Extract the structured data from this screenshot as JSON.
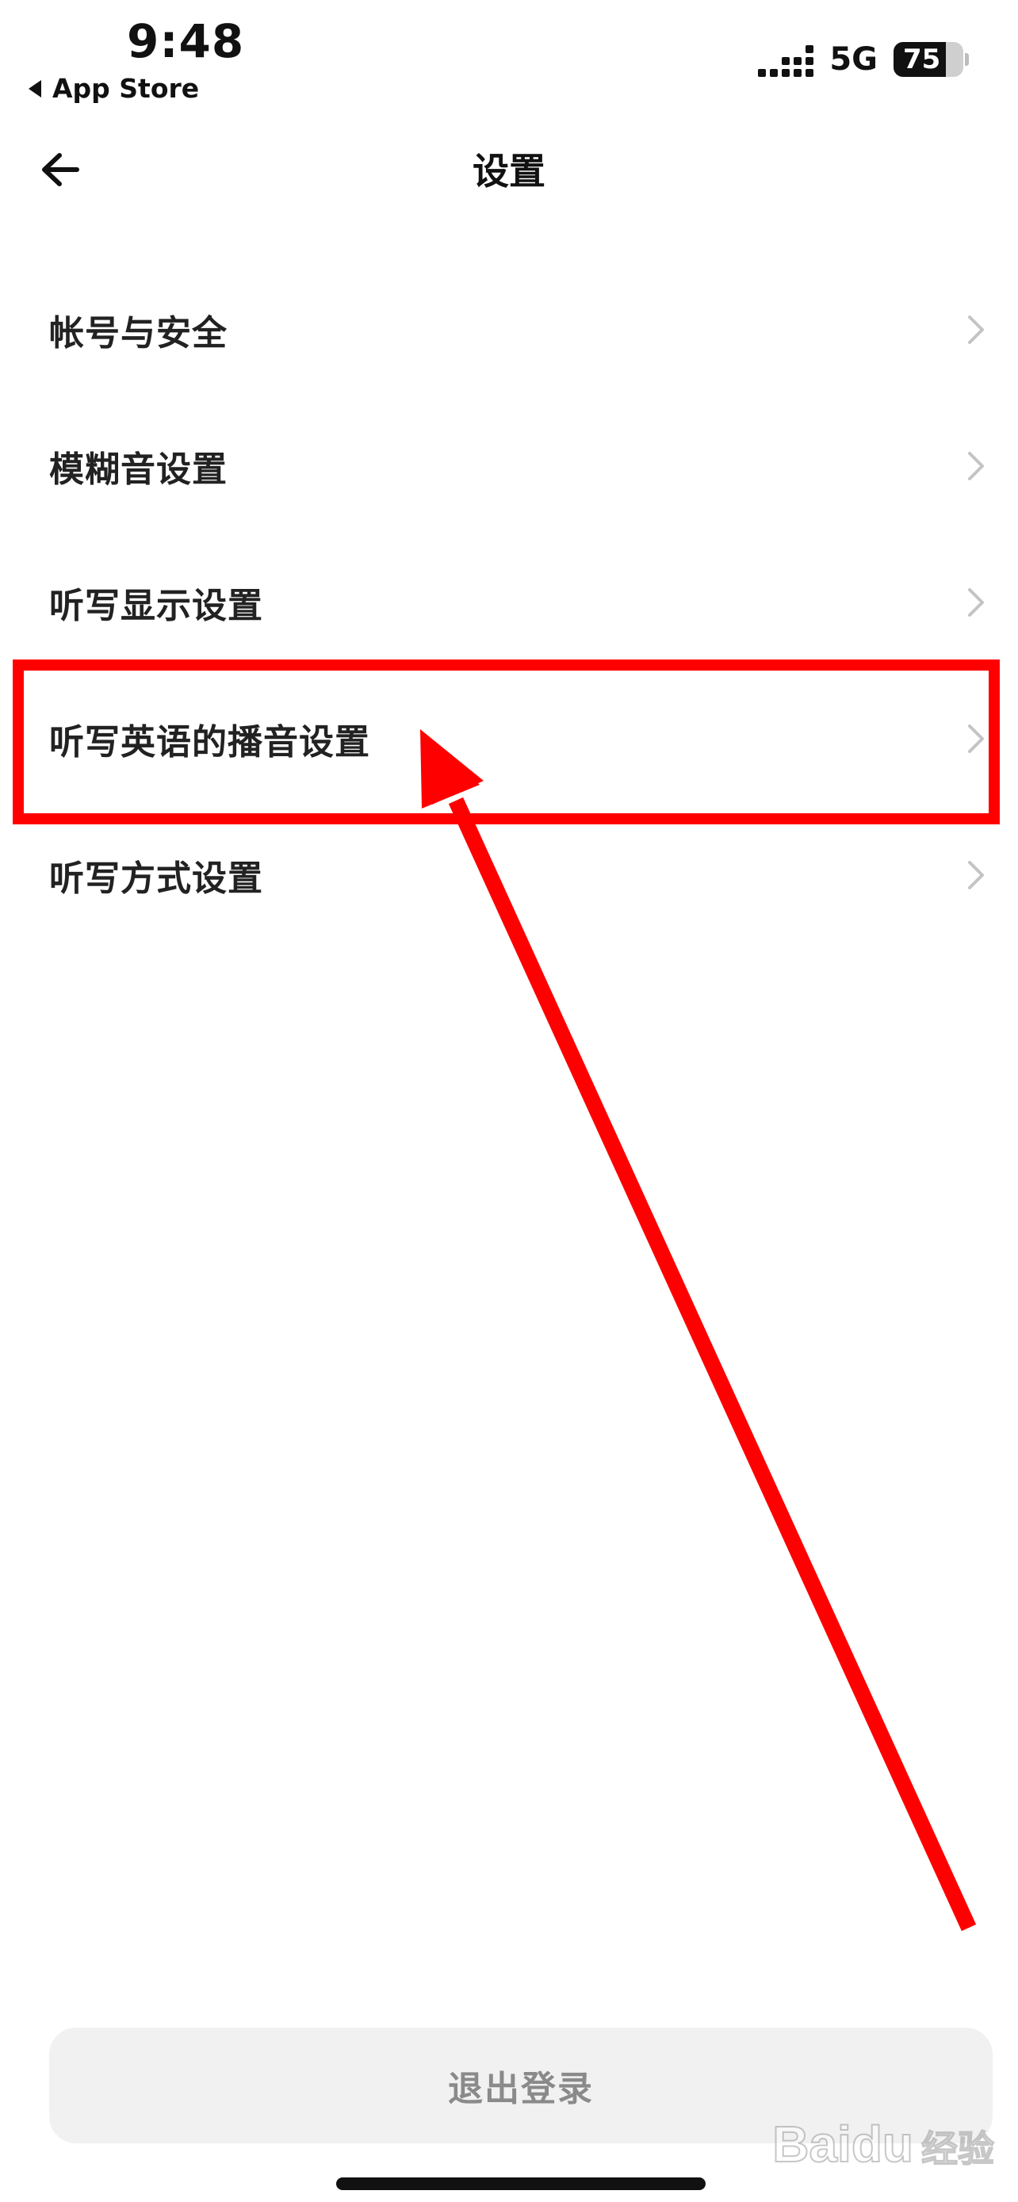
{
  "status_bar": {
    "time": "9:48",
    "back_app": "App Store",
    "network": "5G",
    "battery_level": "75",
    "battery_fraction": 0.75
  },
  "nav": {
    "title": "设置",
    "back_icon": "arrow-left-icon"
  },
  "settings": {
    "items": [
      {
        "label": "帐号与安全"
      },
      {
        "label": "模糊音设置"
      },
      {
        "label": "听写显示设置"
      },
      {
        "label": "听写英语的播音设置"
      },
      {
        "label": "听写方式设置"
      }
    ],
    "chevron_icon": "chevron-right-icon"
  },
  "logout": {
    "label": "退出登录"
  },
  "watermark": {
    "logo": "Baidu",
    "sub": "经验"
  },
  "colors": {
    "annotation": "#ff0000",
    "logout_bg": "#f1f1f1",
    "logout_text": "#8a8a8a",
    "chevron": "#c4c4c4"
  }
}
